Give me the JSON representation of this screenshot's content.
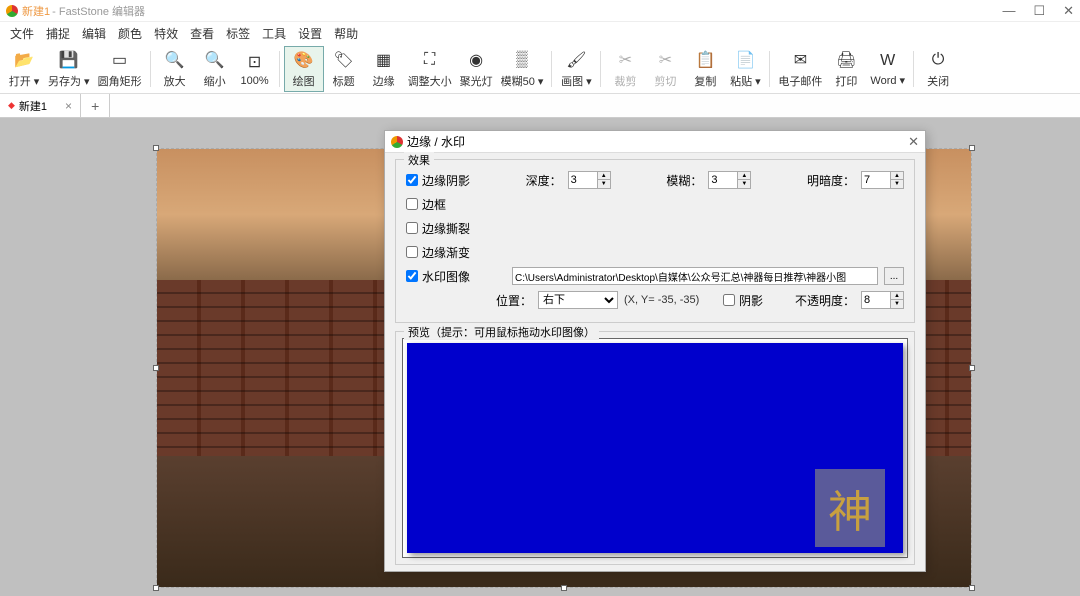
{
  "titlebar": {
    "doc": "新建1",
    "app": " - FastStone 编辑器"
  },
  "menus": [
    "文件",
    "捕捉",
    "编辑",
    "颜色",
    "特效",
    "查看",
    "标签",
    "工具",
    "设置",
    "帮助"
  ],
  "toolbar": [
    {
      "label": "打开",
      "icon": "📂",
      "arrow": true
    },
    {
      "label": "另存为",
      "icon": "💾",
      "arrow": true
    },
    {
      "label": "圆角矩形",
      "icon": "▭"
    },
    {
      "sep": true
    },
    {
      "label": "放大",
      "icon": "🔍"
    },
    {
      "label": "缩小",
      "icon": "🔍"
    },
    {
      "label": "100%",
      "icon": "⊡"
    },
    {
      "sep": true
    },
    {
      "label": "绘图",
      "icon": "🎨",
      "accent": true
    },
    {
      "label": "标题",
      "icon": "🏷"
    },
    {
      "label": "边缘",
      "icon": "▦"
    },
    {
      "label": "调整大小",
      "icon": "⛶"
    },
    {
      "label": "聚光灯",
      "icon": "◉"
    },
    {
      "label": "模糊50",
      "icon": "▒",
      "arrow": true
    },
    {
      "sep": true
    },
    {
      "label": "画图",
      "icon": "🖌",
      "arrow": true
    },
    {
      "sep": true
    },
    {
      "label": "裁剪",
      "icon": "✂",
      "disabled": true
    },
    {
      "label": "剪切",
      "icon": "✂",
      "disabled": true
    },
    {
      "label": "复制",
      "icon": "📋"
    },
    {
      "label": "粘贴",
      "icon": "📄",
      "arrow": true
    },
    {
      "sep": true
    },
    {
      "label": "电子邮件",
      "icon": "✉"
    },
    {
      "label": "打印",
      "icon": "🖨"
    },
    {
      "label": "Word",
      "icon": "W",
      "arrow": true
    },
    {
      "sep": true
    },
    {
      "label": "关闭",
      "icon": "⏻"
    }
  ],
  "tab": {
    "name": "新建1",
    "close": "×",
    "new": "+"
  },
  "dialog": {
    "title": "边缘 / 水印",
    "effects_legend": "效果",
    "cb_shadow": "边缘阴影",
    "cb_border": "边框",
    "cb_tear": "边缘撕裂",
    "cb_fade": "边缘渐变",
    "cb_wm": "水印图像",
    "depth_label": "深度：",
    "depth": "3",
    "blur_label": "模糊：",
    "blur": "3",
    "bright_label": "明暗度：",
    "bright": "7",
    "path": "C:\\Users\\Administrator\\Desktop\\自媒体\\公众号汇总\\神器每日推荐\\神器小图",
    "browse": "...",
    "pos_label": "位置：",
    "pos_value": "右下",
    "coords": "(X, Y= -35, -35)",
    "cb_shadow2": "阴影",
    "opacity_label": "不透明度：",
    "opacity": "8",
    "preview_legend": "预览（提示：可用鼠标拖动水印图像）",
    "wm_char": "神"
  }
}
